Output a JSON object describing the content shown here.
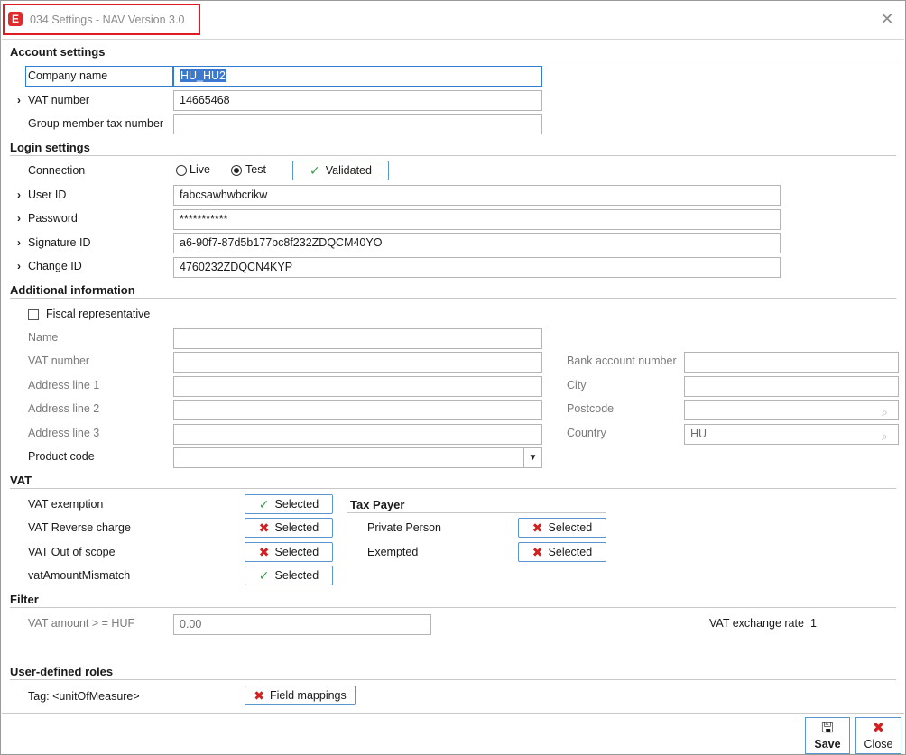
{
  "window": {
    "title": "034 Settings - NAV Version 3.0",
    "app_icon": "E"
  },
  "account": {
    "header": "Account settings",
    "company_name_label": "Company name",
    "company_name_value": "HU_HU2",
    "vat_number_label": "VAT number",
    "vat_number_value": "14665468",
    "group_tax_label": "Group member tax number",
    "group_tax_value": ""
  },
  "login": {
    "header": "Login settings",
    "connection_label": "Connection",
    "live_label": "Live",
    "test_label": "Test",
    "selected_connection": "Test",
    "validated_label": "Validated",
    "user_id_label": "User ID",
    "user_id_value": "fabcsawhwbcrikw",
    "password_label": "Password",
    "password_value": "***********",
    "signature_id_label": "Signature ID",
    "signature_id_value": "a6-90f7-87d5b177bc8f232ZDQCM40YO",
    "change_id_label": "Change ID",
    "change_id_value": "4760232ZDQCN4KYP"
  },
  "additional": {
    "header": "Additional information",
    "fiscal_rep_label": "Fiscal representative",
    "fiscal_rep_checked": false,
    "name_label": "Name",
    "vat_number_label": "VAT number",
    "address1_label": "Address line 1",
    "address2_label": "Address line 2",
    "address3_label": "Address line 3",
    "product_code_label": "Product code",
    "bank_account_label": "Bank account number",
    "city_label": "City",
    "postcode_label": "Postcode",
    "country_label": "Country",
    "country_value": "HU"
  },
  "vat": {
    "header": "VAT",
    "exemption_label": "VAT exemption",
    "reverse_label": "VAT Reverse charge",
    "out_of_scope_label": "VAT Out of scope",
    "mismatch_label": "vatAmountMismatch",
    "selected_label": "Selected",
    "tax_payer_header": "Tax Payer",
    "private_person_label": "Private Person",
    "exempted_label": "Exempted"
  },
  "filter": {
    "header": "Filter",
    "amount_label": "VAT amount > = HUF",
    "amount_value": "0.00",
    "exchange_rate_label": "VAT exchange rate",
    "exchange_rate_value": "1"
  },
  "roles": {
    "header": "User-defined roles",
    "tag_label": "Tag: <unitOfMeasure>",
    "field_mappings_label": "Field mappings"
  },
  "footer": {
    "save_label": "Save",
    "close_label": "Close"
  },
  "colors": {
    "accent": "#5b95cf",
    "check": "#2ea043",
    "cross": "#d32020",
    "title_highlight": "#e01b24"
  }
}
